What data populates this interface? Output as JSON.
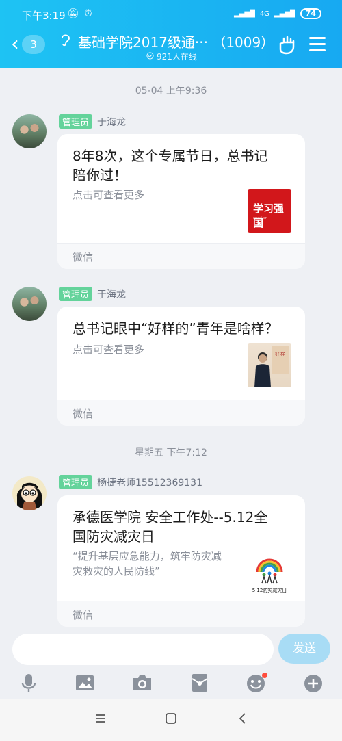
{
  "status_bar": {
    "time": "下午3:19",
    "network": "4G",
    "battery": "74"
  },
  "header": {
    "unread_count": "3",
    "group_name": "基础学院2017级通··· （1009）",
    "online_text": "921人在线"
  },
  "messages": [
    {
      "timestamp": "05-04 上午9:36",
      "badge": "管理员",
      "sender": "于海龙",
      "title_line1": "8年8次，这个专属节日，总书记",
      "title_line2": "陪你过！",
      "subtitle": "点击可查看更多",
      "source": "微信",
      "thumb_text": "学习强国",
      "thumb_sub": "xuexi.cn"
    },
    {
      "badge": "管理员",
      "sender": "于海龙",
      "title_line1": "总书记眼中“好样的”青年是啥样？",
      "subtitle": "点击可查看更多",
      "source": "微信"
    },
    {
      "timestamp": "星期五 下午7:12",
      "badge": "管理员",
      "sender": "杨捷老师15512369131",
      "title_line1": "承德医学院 安全工作处--5.12全",
      "title_line2": "国防灾减灾日",
      "subtitle_line1": "“提升基层应急能力，筑牢防灾减",
      "subtitle_line2": "灾救灾的人民防线”",
      "source": "微信",
      "thumb_caption": "5·12防灾减灾日"
    }
  ],
  "input": {
    "placeholder": "",
    "send_label": "发送"
  },
  "toolbar": [
    "mic-icon",
    "image-icon",
    "camera-icon",
    "red-packet-icon",
    "emoji-icon",
    "plus-icon"
  ],
  "colors": {
    "header_start": "#1ec3f3",
    "header_end": "#17a9f2",
    "admin_badge": "#64d39b",
    "send_disabled": "#a8dcf5"
  }
}
